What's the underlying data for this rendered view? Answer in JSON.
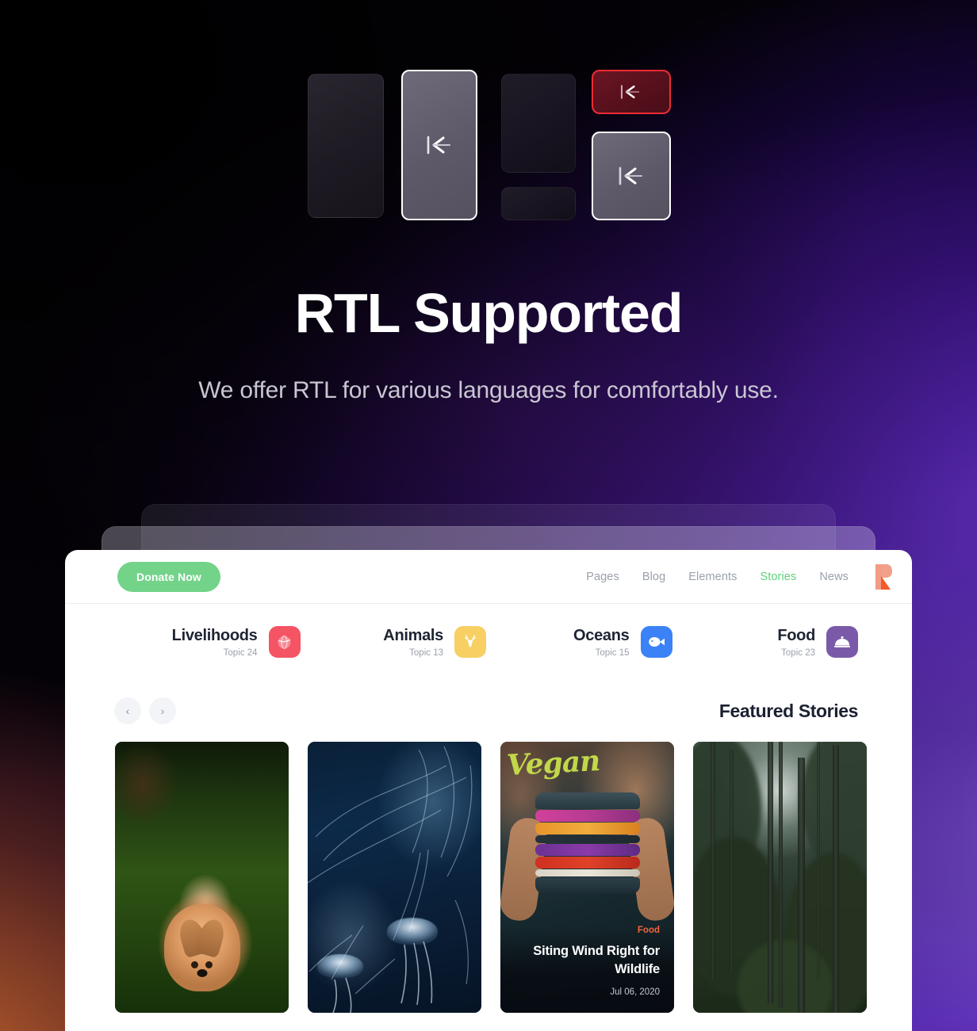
{
  "hero": {
    "title": "RTL Supported",
    "subtitle": "We offer RTL for various languages for comfortably use."
  },
  "illustration": {
    "name": "rtl-direction-boxes",
    "boxes": [
      {
        "name": "box-dark-tall-left",
        "state": "inactive",
        "icon": null
      },
      {
        "name": "box-light-selected",
        "state": "selected",
        "icon": "rtl-arrow-icon"
      },
      {
        "name": "box-dark-upper",
        "state": "inactive",
        "icon": null
      },
      {
        "name": "box-dark-lower",
        "state": "inactive",
        "icon": null
      },
      {
        "name": "box-red-highlight",
        "state": "error",
        "icon": "rtl-arrow-icon"
      },
      {
        "name": "box-light-secondary",
        "state": "selected",
        "icon": "rtl-arrow-icon"
      }
    ],
    "colors": {
      "red_border": "#ee2b33",
      "red_fill": "#5a1220",
      "light_fill": "#655f70",
      "dark_fill": "#211d28"
    }
  },
  "mockup": {
    "nav": {
      "donate_label": "Donate Now",
      "donate_color": "#72d389",
      "links": [
        {
          "label": "Pages",
          "active": false
        },
        {
          "label": "Blog",
          "active": false
        },
        {
          "label": "Elements",
          "active": false
        },
        {
          "label": "Stories",
          "active": true
        },
        {
          "label": "News",
          "active": false
        }
      ],
      "active_color": "#5ed17c",
      "logo_name": "brand-logo-icon"
    },
    "topics": [
      {
        "name": "Livelihoods",
        "count": "Topic 24",
        "icon": "globe-icon",
        "color": "#f55464"
      },
      {
        "name": "Animals",
        "count": "Topic 13",
        "icon": "deer-icon",
        "color": "#f7cf63"
      },
      {
        "name": "Oceans",
        "count": "Topic 15",
        "icon": "fish-icon",
        "color": "#3b82f6"
      },
      {
        "name": "Food",
        "count": "Topic 23",
        "icon": "food-cover-icon",
        "color": "#7a5aa8"
      }
    ],
    "featured": {
      "heading": "Featured Stories",
      "prev_label": "‹",
      "next_label": "›"
    },
    "cards": [
      {
        "art": "fox-in-forest",
        "category": "",
        "title": "",
        "date": "",
        "has_overlay": false
      },
      {
        "art": "jellyfish-underwater",
        "category": "",
        "title": "",
        "date": "",
        "has_overlay": false
      },
      {
        "art": "vegan-sandwich",
        "category": "Food",
        "title": "Siting Wind Right for Wildlife",
        "date": "Jul 06, 2020",
        "has_overlay": true,
        "category_color": "#f4643c"
      },
      {
        "art": "misty-forest",
        "category": "",
        "title": "",
        "date": "",
        "has_overlay": false
      }
    ]
  },
  "background": {
    "dark": "#050208",
    "violet": "#5c2fb4",
    "violet_light": "#9b7de0",
    "warm_orange": "#c4692f"
  }
}
